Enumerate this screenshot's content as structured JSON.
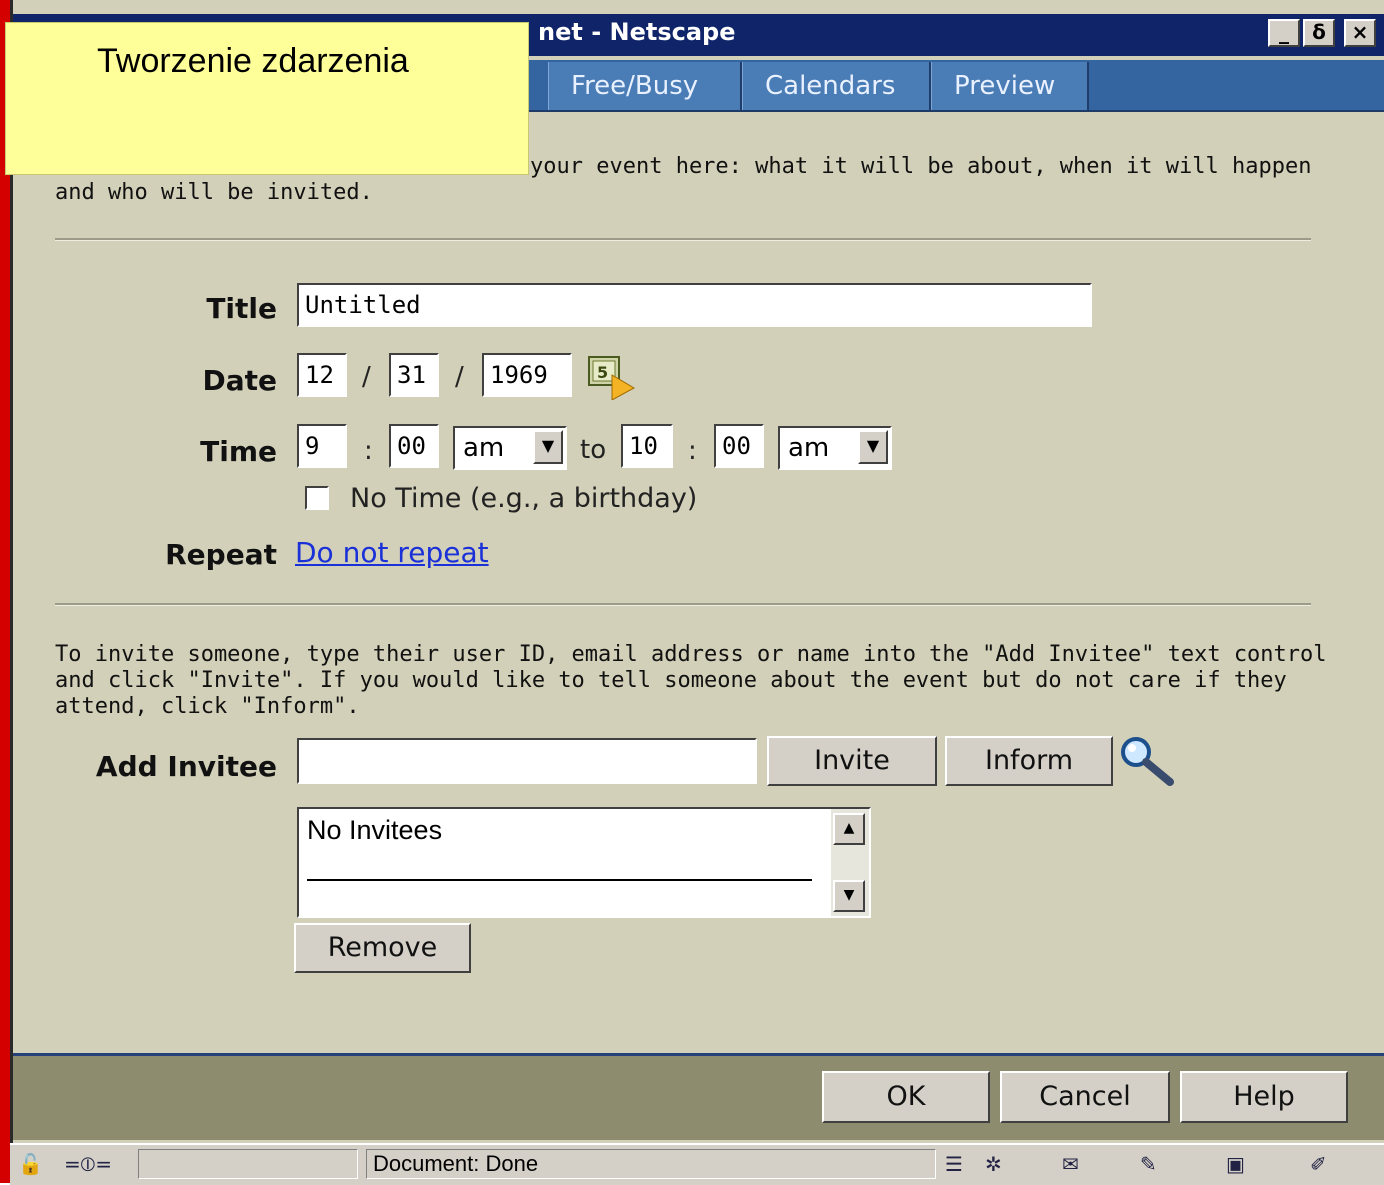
{
  "overlay_note": {
    "text": "Tworzenie zdarzenia"
  },
  "window": {
    "title": "net - Netscape",
    "controls": {
      "minimize": "_",
      "maximize": "ẟ",
      "close": "×"
    }
  },
  "tabs": [
    "Free/Busy",
    "Calendars",
    "Preview"
  ],
  "intro": {
    "line1": "your event here: what it will be about, when it will happen",
    "line2": "and who will be invited."
  },
  "form": {
    "title_label": "Title",
    "title_value": "Untitled",
    "date_label": "Date",
    "date_month": "12",
    "date_day": "31",
    "date_year": "1969",
    "date_sep": "/",
    "time_label": "Time",
    "start_hour": "9",
    "start_min": "00",
    "start_ampm": "am",
    "to_text": "to",
    "end_hour": "10",
    "end_min": "00",
    "end_ampm": "am",
    "time_sep": ":",
    "no_time_label": "No Time (e.g., a birthday)",
    "no_time_checked": false,
    "repeat_label": "Repeat",
    "repeat_value": "Do not repeat"
  },
  "invite": {
    "instructions": [
      "To invite someone, type their user ID, email address or name into the \"Add Invitee\" text control",
      "and click \"Invite\". If you would like to tell someone about the event but do not care if they",
      "attend, click \"Inform\"."
    ],
    "add_label": "Add Invitee",
    "input_value": "",
    "invite_button": "Invite",
    "inform_button": "Inform",
    "list_items": [
      "No Invitees"
    ],
    "remove_button": "Remove"
  },
  "footer": {
    "ok": "OK",
    "cancel": "Cancel",
    "help": "Help"
  },
  "status": {
    "text": "Document: Done"
  },
  "icons": [
    "security-lock-icon",
    "connection-plug-icon",
    "calendar-icon",
    "search-magnifier-icon",
    "component-bar-icons"
  ],
  "colors": {
    "titlebar": "#10246a",
    "tab": "#4a7cb6",
    "panel": "#d2d0b8",
    "note": "#ffff99",
    "link": "#1a30d8"
  }
}
